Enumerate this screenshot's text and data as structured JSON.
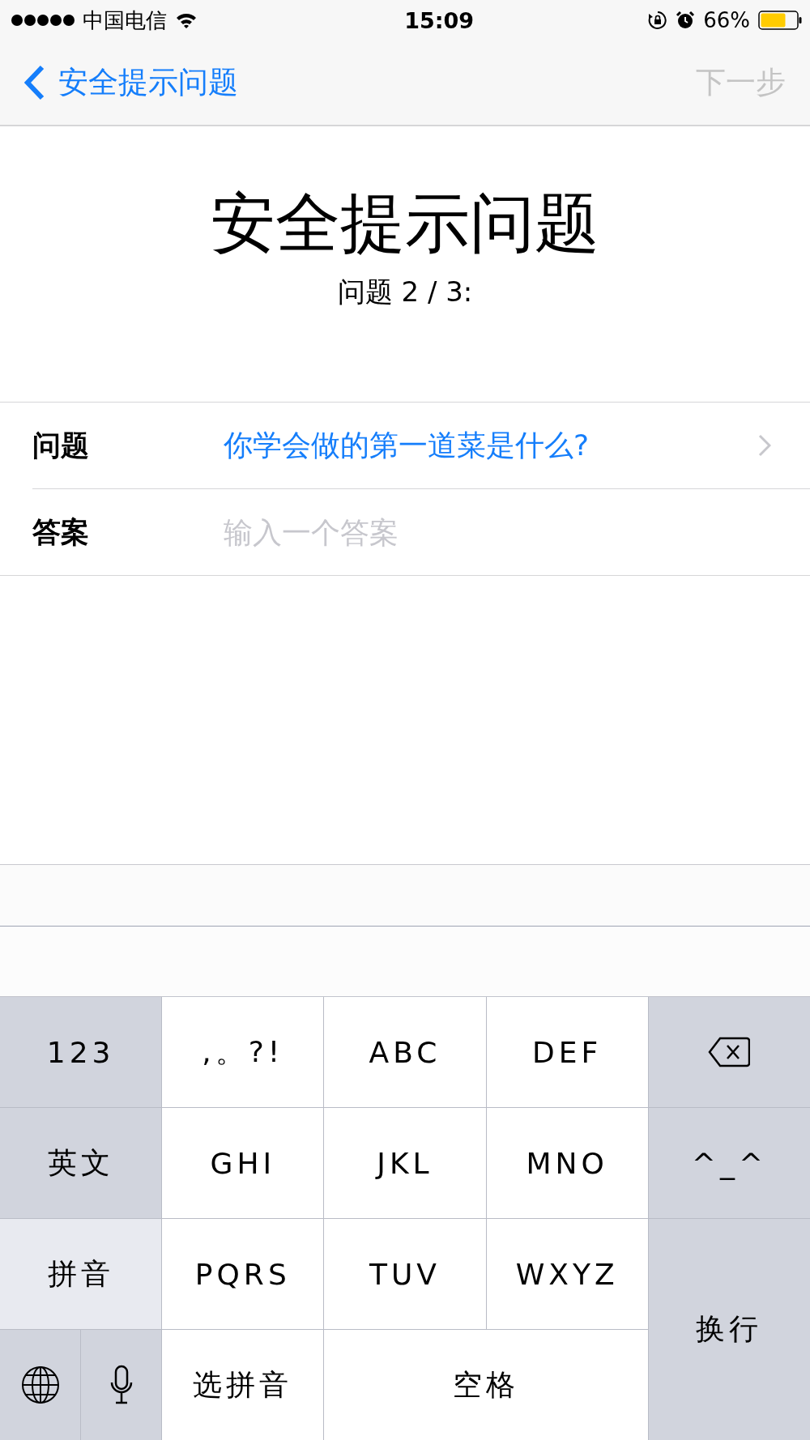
{
  "status_bar": {
    "carrier": "中国电信",
    "time": "15:09",
    "battery": "66%"
  },
  "nav": {
    "back": "安全提示问题",
    "next": {
      "label": "下一步",
      "disabled": true
    }
  },
  "header": {
    "title": "安全提示问题",
    "subtitle": "问题 2 / 3:"
  },
  "form": [
    {
      "kind": "picker",
      "label": "问题",
      "value": "你学会做的第一道菜是什么?"
    },
    {
      "kind": "input",
      "label": "答案",
      "placeholder": "输入一个答案"
    }
  ],
  "keyboard": [
    {
      "kind": "function",
      "label": "123",
      "selected": false
    },
    {
      "kind": "letter",
      "label": ",。?!",
      "selected": false
    },
    {
      "kind": "letter",
      "label": "ABC",
      "selected": false
    },
    {
      "kind": "letter",
      "label": "DEF",
      "selected": false
    },
    {
      "kind": "delete",
      "selected": false
    },
    {
      "kind": "function",
      "label": "英文",
      "selected": false
    },
    {
      "kind": "letter",
      "label": "GHI",
      "selected": false
    },
    {
      "kind": "letter",
      "label": "JKL",
      "selected": false
    },
    {
      "kind": "letter",
      "label": "MNO",
      "selected": false
    },
    {
      "kind": "function",
      "label": "^_^",
      "selected": false
    },
    {
      "kind": "function",
      "label": "拼音",
      "selected": true
    },
    {
      "kind": "letter",
      "label": "PQRS",
      "selected": false
    },
    {
      "kind": "letter",
      "label": "TUV",
      "selected": false
    },
    {
      "kind": "letter",
      "label": "WXYZ",
      "selected": false
    },
    {
      "kind": "return",
      "label": "换行",
      "selected": false
    },
    {
      "kind": "globe",
      "selected": false
    },
    {
      "kind": "mic",
      "selected": false
    },
    {
      "kind": "letter",
      "label": "选拼音",
      "selected": false
    },
    {
      "kind": "space",
      "label": "空格",
      "selected": false
    }
  ]
}
